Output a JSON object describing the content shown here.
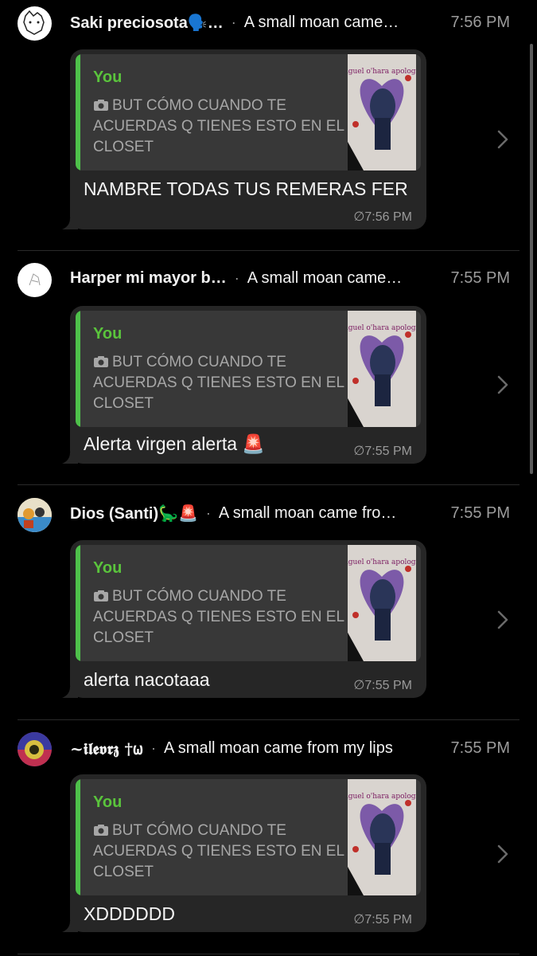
{
  "messages": [
    {
      "sender": "Saki preciosota🗣️…",
      "separator": "·",
      "group": "A small moan came…",
      "time": "7:56 PM",
      "quote": {
        "author": "You",
        "text": "BUT CÓMO CUANDO TE ACUERDAS Q TIENES ESTO EN EL CLOSET",
        "thumb_text": "miguel o'hara apologist"
      },
      "reply": "NAMBRE TODAS TUS REMERAS FER",
      "meta": "∅7:56 PM"
    },
    {
      "sender": "Harper mi mayor b…",
      "separator": "·",
      "group": "A small moan came…",
      "time": "7:55 PM",
      "quote": {
        "author": "You",
        "text": "BUT CÓMO CUANDO TE ACUERDAS Q TIENES ESTO EN EL CLOSET",
        "thumb_text": "miguel o'hara apologist"
      },
      "reply": "Alerta virgen alerta 🚨",
      "meta": "∅7:55 PM"
    },
    {
      "sender": "Dios (Santi)🦕🚨",
      "separator": "·",
      "group": "A small moan came fro…",
      "time": "7:55 PM",
      "quote": {
        "author": "You",
        "text": "BUT CÓMO CUANDO TE ACUERDAS Q TIENES ESTO EN EL CLOSET",
        "thumb_text": "miguel o'hara apologist"
      },
      "reply": "alerta nacotaaa",
      "meta": "∅7:55 PM"
    },
    {
      "sender": "~𝖎𝖑𝖊𝖛𝖗𝖟 †𐐶",
      "separator": "·",
      "group": "A small moan came from my lips",
      "time": "7:55 PM",
      "quote": {
        "author": "You",
        "text": "BUT CÓMO CUANDO TE ACUERDAS Q TIENES ESTO EN EL CLOSET",
        "thumb_text": "miguel o'hara apologist"
      },
      "reply": "XDDDDDD",
      "meta": "∅7:55 PM"
    }
  ],
  "colors": {
    "background": "#000000",
    "bubble": "#262626",
    "quote_bg": "#383838",
    "quote_bar": "#4ec04a",
    "quote_author": "#5ac43c",
    "secondary_text": "#9c9c9c"
  },
  "icons": [
    "camera-icon",
    "chevron-right-icon",
    "star-icon"
  ]
}
